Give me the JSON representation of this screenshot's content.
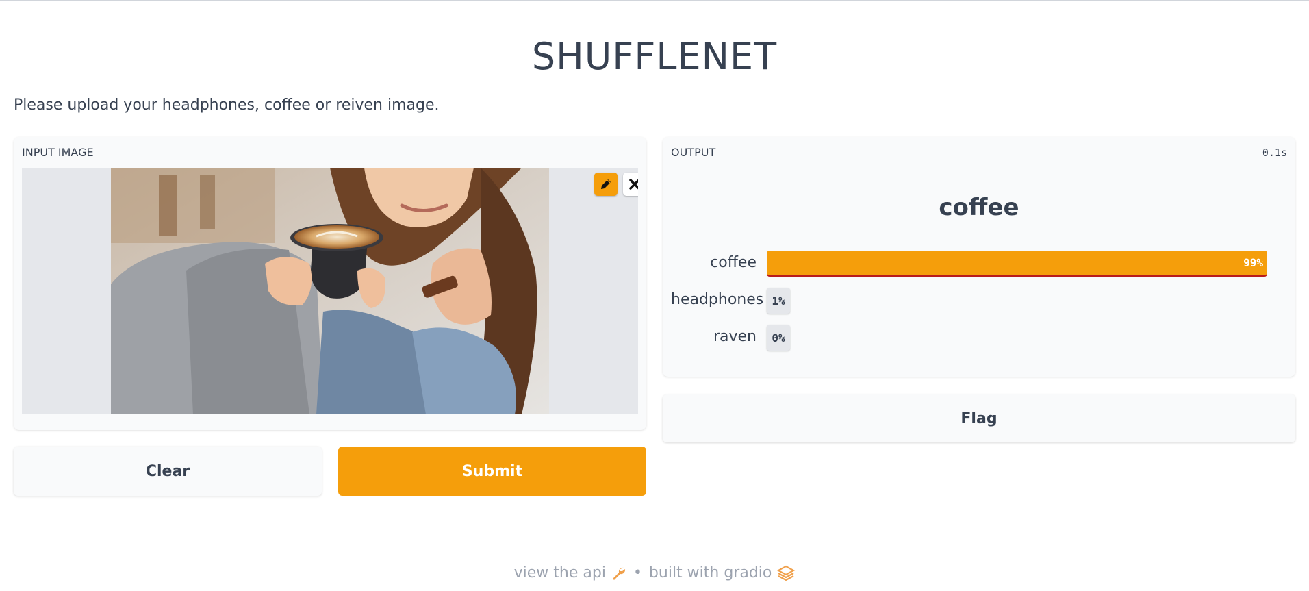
{
  "app": {
    "title": "SHUFFLENET",
    "description": "Please upload your headphones, coffee or reiven image."
  },
  "input_panel": {
    "label": "INPUT IMAGE",
    "image_alt": "woman holding a cup of latte",
    "edit_icon": "pencil-icon",
    "remove_icon": "close-icon"
  },
  "buttons": {
    "clear_label": "Clear",
    "submit_label": "Submit",
    "flag_label": "Flag"
  },
  "output_panel": {
    "label": "OUTPUT",
    "time": "0.1s",
    "top_label": "coffee",
    "confidences": [
      {
        "label": "coffee",
        "value_text": "99%",
        "value": 0.99
      },
      {
        "label": "headphones",
        "value_text": "1%",
        "value": 0.01
      },
      {
        "label": "raven",
        "value_text": "0%",
        "value": 0.0
      }
    ]
  },
  "footer": {
    "api_link": "view the api",
    "separator": "•",
    "built_with": "built with gradio"
  },
  "colors": {
    "accent": "#f59e0b",
    "text": "#374151",
    "panel_bg": "#f9fafb",
    "muted": "#9ca3af"
  }
}
